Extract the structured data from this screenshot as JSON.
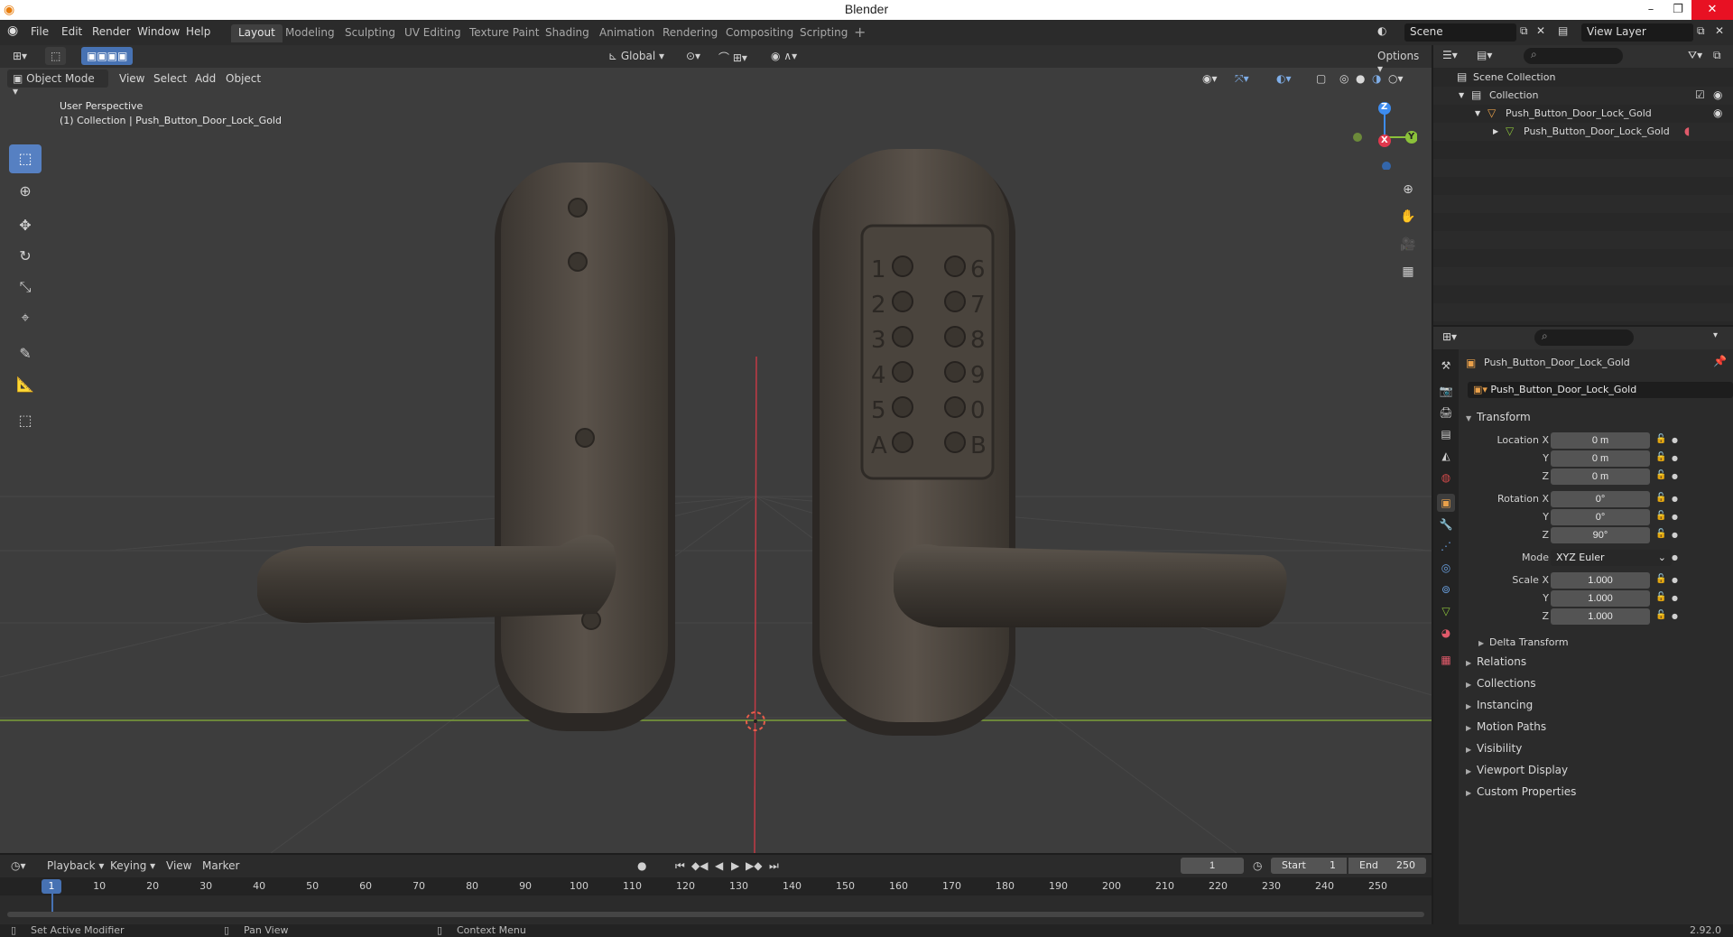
{
  "window": {
    "title": "Blender",
    "minimize": "–",
    "restore": "❐",
    "close": "✕"
  },
  "menu": [
    "File",
    "Edit",
    "Render",
    "Window",
    "Help"
  ],
  "workspaces": [
    "Layout",
    "Modeling",
    "Sculpting",
    "UV Editing",
    "Texture Paint",
    "Shading",
    "Animation",
    "Rendering",
    "Compositing",
    "Scripting"
  ],
  "workspace_add": "+",
  "scene": {
    "name": "Scene",
    "view_layer": "View Layer"
  },
  "viewport": {
    "transform_orientation": "Global",
    "options": "Options",
    "mode": "Object Mode",
    "menus": [
      "View",
      "Select",
      "Add",
      "Object"
    ],
    "info_line1": "User Perspective",
    "info_line2": "(1) Collection | Push_Button_Door_Lock_Gold",
    "gizmo": {
      "x": "X",
      "y": "Y",
      "z": "Z"
    },
    "keypad_left": [
      "1",
      "2",
      "3",
      "4",
      "5",
      "A"
    ],
    "keypad_right": [
      "6",
      "7",
      "8",
      "9",
      "0",
      "B"
    ]
  },
  "outliner": {
    "rows": [
      {
        "label": "Scene Collection"
      },
      {
        "label": "Collection"
      },
      {
        "label": "Push_Button_Door_Lock_Gold"
      },
      {
        "label": "Push_Button_Door_Lock_Gold"
      }
    ]
  },
  "properties": {
    "object_name": "Push_Button_Door_Lock_Gold",
    "object_field": "Push_Button_Door_Lock_Gold",
    "transform_title": "Transform",
    "location": {
      "label": "Location X",
      "x": "0 m",
      "y": "0 m",
      "z": "0 m"
    },
    "rotation": {
      "label": "Rotation X",
      "x": "0°",
      "y": "0°",
      "z": "90°"
    },
    "mode": {
      "label": "Mode",
      "value": "XYZ Euler"
    },
    "scale": {
      "label": "Scale X",
      "x": "1.000",
      "y": "1.000",
      "z": "1.000"
    },
    "axis_y": "Y",
    "axis_z": "Z",
    "delta": "Delta Transform",
    "sections": [
      "Relations",
      "Collections",
      "Instancing",
      "Motion Paths",
      "Visibility",
      "Viewport Display",
      "Custom Properties"
    ]
  },
  "timeline": {
    "menus": [
      "Playback",
      "Keying",
      "View",
      "Marker"
    ],
    "current_frame": "1",
    "start_label": "Start",
    "start": "1",
    "end_label": "End",
    "end": "250",
    "ticks": [
      "1",
      "10",
      "20",
      "30",
      "40",
      "50",
      "60",
      "70",
      "80",
      "90",
      "100",
      "110",
      "120",
      "130",
      "140",
      "150",
      "160",
      "170",
      "180",
      "190",
      "200",
      "210",
      "220",
      "230",
      "240",
      "250"
    ]
  },
  "statusbar": {
    "left": "Set Active Modifier",
    "middle": "Pan View",
    "right": "Context Menu",
    "version": "2.92.0"
  },
  "colors": {
    "accent": "#4772b3",
    "axis_x": "#e0384d",
    "axis_y": "#8bc13a",
    "axis_z": "#3d8cf0",
    "object_orange": "#e9a04a"
  }
}
